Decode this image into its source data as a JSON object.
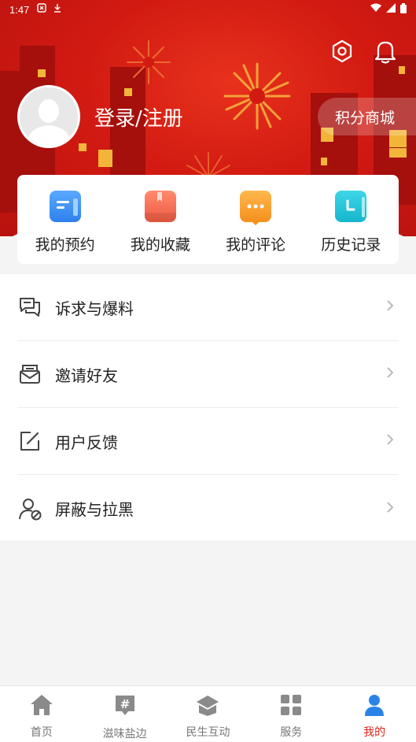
{
  "status_bar": {
    "time": "1:47"
  },
  "header": {
    "login_label": "登录/注册",
    "points_mall_label": "积分商城"
  },
  "quick_actions": [
    {
      "label": "我的预约",
      "icon": "appointment-icon",
      "color": "#3b8ff0"
    },
    {
      "label": "我的收藏",
      "icon": "favorite-icon",
      "color": "#f06b52"
    },
    {
      "label": "我的评论",
      "icon": "comment-icon",
      "color": "#f59a2c"
    },
    {
      "label": "历史记录",
      "icon": "history-icon",
      "color": "#22c3d6"
    }
  ],
  "menu": [
    {
      "label": "诉求与爆料",
      "icon": "chat-icon"
    },
    {
      "label": "邀请好友",
      "icon": "mail-icon"
    },
    {
      "label": "用户反馈",
      "icon": "edit-icon"
    },
    {
      "label": "屏蔽与拉黑",
      "icon": "block-user-icon"
    }
  ],
  "tabs": [
    {
      "label": "首页",
      "icon": "home-icon",
      "active": false
    },
    {
      "label": "滋味盐边",
      "icon": "hashtag-icon",
      "active": false
    },
    {
      "label": "民生互动",
      "icon": "interaction-icon",
      "active": false
    },
    {
      "label": "服务",
      "icon": "grid-icon",
      "active": false
    },
    {
      "label": "我的",
      "icon": "user-icon",
      "active": true
    }
  ],
  "colors": {
    "brand_red": "#d21a12",
    "active_tab": "#d9231c",
    "inactive_tab": "#8a8a8a"
  }
}
